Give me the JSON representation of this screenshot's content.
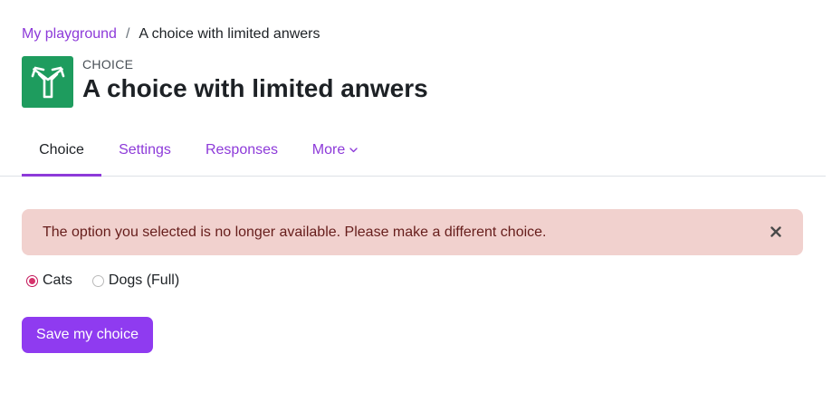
{
  "breadcrumb": {
    "parent": "My playground",
    "separator": "/",
    "current": "A choice with limited anwers"
  },
  "header": {
    "activity_type": "CHOICE",
    "title": "A choice with limited anwers",
    "icon": "signpost-icon",
    "icon_color": "#1e9c5e"
  },
  "tabs": [
    {
      "label": "Choice",
      "active": true
    },
    {
      "label": "Settings",
      "active": false
    },
    {
      "label": "Responses",
      "active": false
    },
    {
      "label": "More",
      "active": false
    }
  ],
  "alert": {
    "message": "The option you selected is no longer available. Please make a different choice.",
    "background": "#f1d1ce"
  },
  "options": [
    {
      "label": "Cats",
      "checked": true
    },
    {
      "label": "Dogs (Full)",
      "checked": false
    }
  ],
  "save_button": {
    "label": "Save my choice",
    "color": "#8f3bf0"
  },
  "accent_color": "#8d3ad9"
}
